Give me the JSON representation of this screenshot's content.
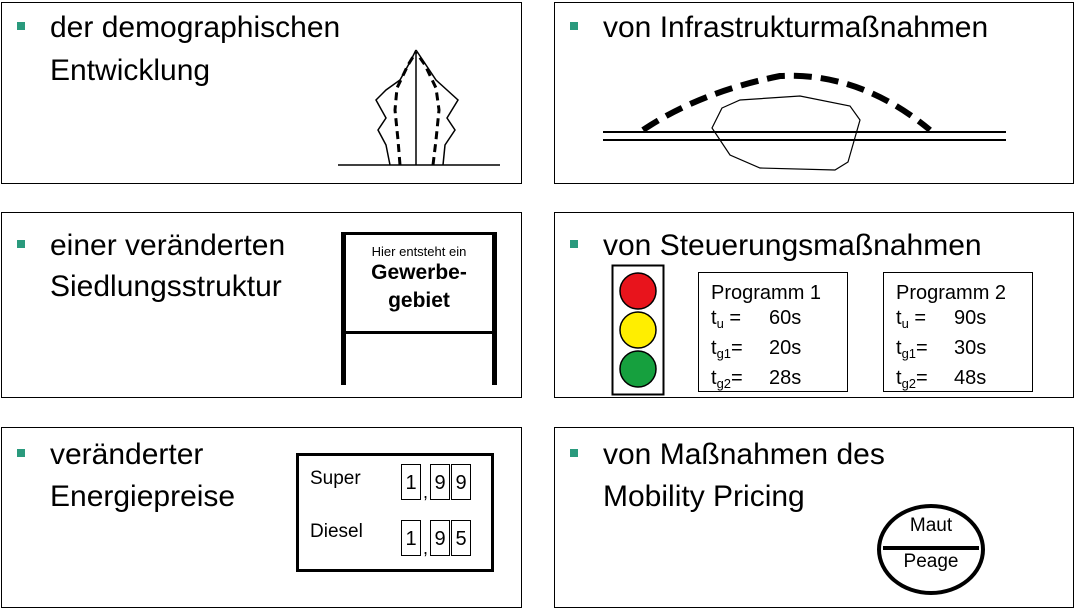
{
  "panels": {
    "demography": {
      "line1": "der demographischen",
      "line2": "Entwicklung"
    },
    "infrastructure": {
      "line1": "von Infrastrukturmaßnahmen"
    },
    "settlement": {
      "line1": "einer veränderten",
      "line2": "Siedlungsstruktur"
    },
    "control": {
      "line1": "von Steuerungsmaßnahmen"
    },
    "energy": {
      "line1": "veränderter",
      "line2": "Energiepreise"
    },
    "pricing": {
      "line1": "von Maßnahmen des",
      "line2": "Mobility Pricing"
    }
  },
  "sign": {
    "small_text": "Hier entsteht ein",
    "line1": "Gewerbe-",
    "line2": "gebiet"
  },
  "traffic_light": {
    "colors": [
      "#e8141c",
      "#ffee00",
      "#16a03e"
    ],
    "housing_color": "#ffffff"
  },
  "programs": [
    {
      "title": "Programm 1",
      "rows": [
        {
          "var": "t",
          "sub": "u",
          "eq": " =",
          "value": "60s"
        },
        {
          "var": "t",
          "sub": "g1",
          "eq": "=",
          "value": "20s"
        },
        {
          "var": "t",
          "sub": "g2",
          "eq": "=",
          "value": "28s"
        }
      ]
    },
    {
      "title": "Programm 2",
      "rows": [
        {
          "var": "t",
          "sub": "u",
          "eq": " =",
          "value": "90s"
        },
        {
          "var": "t",
          "sub": "g1",
          "eq": "=",
          "value": "30s"
        },
        {
          "var": "t",
          "sub": "g2",
          "eq": "=",
          "value": "48s"
        }
      ]
    }
  ],
  "fuel_prices": {
    "super": {
      "label": "Super",
      "d1": "1",
      "comma": ",",
      "d2": "9",
      "d3": "9"
    },
    "diesel": {
      "label": "Diesel",
      "d1": "1",
      "comma": ",",
      "d2": "9",
      "d3": "5"
    }
  },
  "toll_sign": {
    "top": "Maut",
    "bottom": "Peage"
  },
  "colors": {
    "bullet": "#2a9a7d",
    "border": "#000000"
  }
}
